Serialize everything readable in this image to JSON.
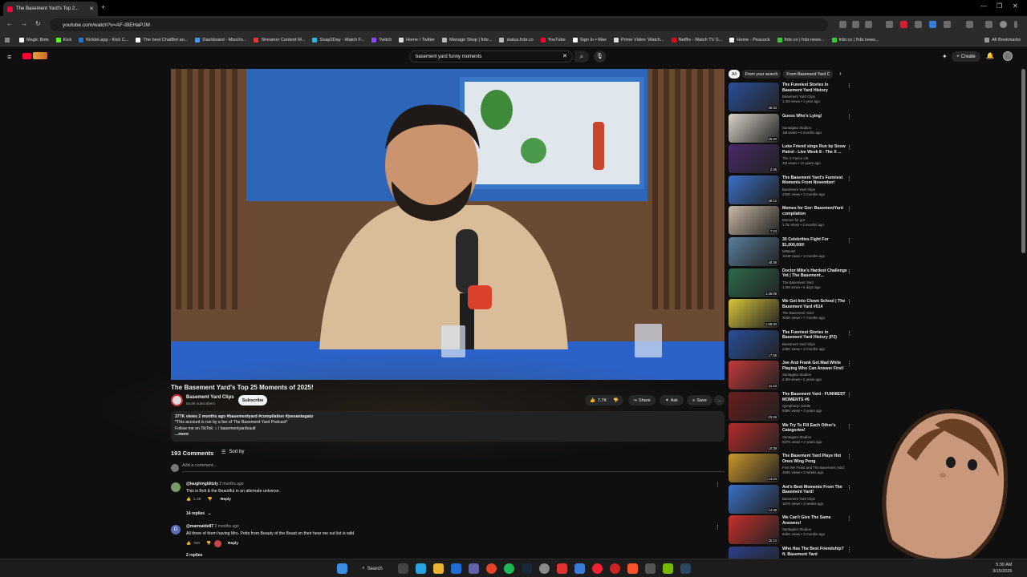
{
  "browser": {
    "tab_title": "The Basement Yard's Top 2...",
    "url": "youtube.com/watch?v=AF-IBEHaPJM",
    "bookmarks": [
      "Magic Bots",
      "Kick",
      "Kicklet.app - Kick C...",
      "The best ChatBot an...",
      "Dashboard - MissXs...",
      "Streamer Content M...",
      "Soap2Day - Watch F...",
      "Twitch",
      "Home / Twitter",
      "Manage Shop | fnbr...",
      "status.fnbr.co",
      "YouTube",
      "Sign In • Max",
      "Prime Video: Watch...",
      "Netflix - Watch TV S...",
      "Home - Peacock",
      "fnbr.co | fnbr.news...",
      "fnbr.co | fnbr.news..."
    ],
    "all_bookmarks": "All Bookmarks"
  },
  "youtube": {
    "search_query": "basement yard funny moments",
    "create_label": "Create",
    "video": {
      "title": "The Basement Yard's Top 25 Moments of 2025!",
      "channel": "Basement Yard Clips",
      "subscribers": "55.8K subscribers",
      "subscribe_label": "Subscribe",
      "likes": "7.7K",
      "share_label": "Share",
      "ask_label": "Ask",
      "save_label": "Save",
      "meta": "377K views  2 months ago  #basementyard #compilation #joesantagato",
      "desc_line1": "*This account is run by a fan of The Basement Yard Podcast*",
      "desc_line2": "Follow me on TikTok: ♪ / basementyardvault",
      "more": "...more"
    },
    "comments": {
      "count_label": "193 Comments",
      "sort_label": "Sort by",
      "add_placeholder": "Add a comment...",
      "items": [
        {
          "author": "@laughingblitzly",
          "time": "2 months ago",
          "text": "This is Beli & the Beautiful in an alternate universe.",
          "likes": "1.3K",
          "reply": "Reply",
          "replies": "14 replies"
        },
        {
          "author": "@marmalde87",
          "time": "2 months ago",
          "text": "All three of them having Mrs. Potts from Beauty of the Beast on their hear me out list is wild",
          "likes": "700",
          "reply": "Reply",
          "replies": "2 replies"
        }
      ]
    },
    "chips": [
      "All",
      "From your search",
      "From Basement Yard C"
    ],
    "recommended": [
      {
        "title": "The Funniest Stories In Basement Yard History",
        "channel": "Basement Yard Clips",
        "stats": "1.4M views • 1 year ago",
        "duration": "38:33",
        "color": "#2a4e9a"
      },
      {
        "title": "Guess Who's Lying!",
        "channel": "Santagato Studios",
        "stats": "1M views • 4 months ago",
        "duration": "26:20",
        "color": "#d9d2c8"
      },
      {
        "title": "Luke Friend sings Run by Snow Patrol - Live Week 8 - The X ...",
        "channel": "The X Factor UK",
        "stats": "4M views • 12 years ago",
        "duration": "2:35",
        "color": "#4a2a6a"
      },
      {
        "title": "The Basement Yard's Funniest Moments From November!",
        "channel": "Basement Yard Clips",
        "stats": "233K views • 2 months ago",
        "duration": "38:12",
        "color": "#3b70c8"
      },
      {
        "title": "Memes for Gor: BasementYard compilation",
        "channel": "Memes for gor",
        "stats": "1.7K views • 3 months ago",
        "duration": "7:23",
        "color": "#c9b7a4"
      },
      {
        "title": "30 Celebrities Fight For $1,000,000!",
        "channel": "MrBeast",
        "stats": "111M views • 2 months ago",
        "duration": "45:38",
        "color": "#5b7e9e"
      },
      {
        "title": "Doctor Mike's Hardest Challenge Yet | The Basement...",
        "channel": "The Basement Yard",
        "stats": "1.4M views • 6 days ago",
        "duration": "1:49:09",
        "color": "#2c6a4a"
      },
      {
        "title": "We Got Into Clown School | The Basement Yard #514",
        "channel": "The Basement Yard",
        "stats": "304K views • 7 months ago",
        "duration": "1:58:30",
        "color": "#d6c43a"
      },
      {
        "title": "The Funniest Stories In Basement Yard History (P2)",
        "channel": "Basement Yard Clips",
        "stats": "248K views • 4 months ago",
        "duration": "17:45",
        "color": "#2a4e9a"
      },
      {
        "title": "Joe And Frank Get Mad While Playing Who Can Answer First!",
        "channel": "Santagato Studios",
        "stats": "2.3M views • 2 years ago",
        "duration": "11:23",
        "color": "#c23a3a"
      },
      {
        "title": "The Basement Yard - FUNNIEST MOMENTS #6",
        "channel": "Symphonic Subtle",
        "stats": "938K views • 3 years ago",
        "duration": "23:26",
        "color": "#6a1d1d"
      },
      {
        "title": "We Try To Fill Each Other's Categories!",
        "channel": "Santagato Studios",
        "stats": "937K views • 2 years ago",
        "duration": "10:39",
        "color": "#b32a2a"
      },
      {
        "title": "The Basement Yard Plays Hot Ones Wing Pong",
        "channel": "First We Feast and The Basement Yard",
        "stats": "483K views • 3 weeks ago",
        "duration": "14:24",
        "color": "#c9962b"
      },
      {
        "title": "Ant's Best Moments From The Basement Yard!",
        "channel": "Basement Yard Clips",
        "stats": "167K views • 3 weeks ago",
        "duration": "14:39",
        "color": "#3b70c8"
      },
      {
        "title": "We Can't Give The Same Answers!",
        "channel": "Santagato Studios",
        "stats": "840K views • 3 months ago",
        "duration": "15:14",
        "color": "#c6302b"
      },
      {
        "title": "Who Has The Best Friendship? ft. Basement Yard",
        "channel": "",
        "stats": "",
        "duration": "",
        "color": "#2d3f87"
      }
    ]
  },
  "taskbar": {
    "search_label": "Search",
    "time": "5:30 AM",
    "date": "3/15/2026"
  }
}
